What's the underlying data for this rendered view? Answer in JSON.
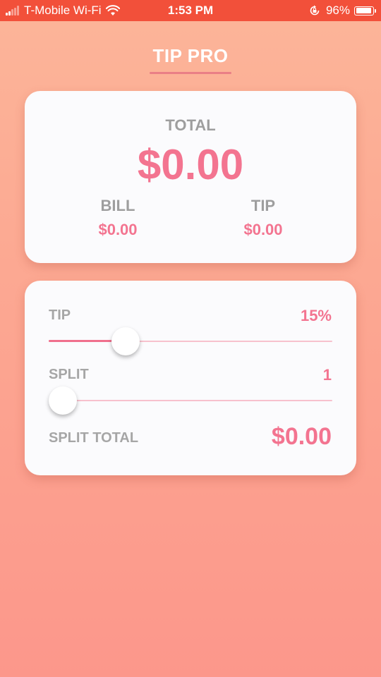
{
  "status_bar": {
    "carrier": "T-Mobile Wi-Fi",
    "time": "1:53 PM",
    "battery_percent": "96%",
    "battery_level": 0.96,
    "signal_bars": 2,
    "signal_total": 5,
    "icons": [
      "signal-icon",
      "wifi-icon",
      "orientation-lock-icon",
      "battery-icon"
    ],
    "background_color": "#f2503a"
  },
  "header": {
    "title": "TIP PRO"
  },
  "totals": {
    "total_label": "TOTAL",
    "total_value": "$0.00",
    "bill_label": "BILL",
    "bill_value": "$0.00",
    "tip_label": "TIP",
    "tip_value": "$0.00"
  },
  "controls": {
    "tip_label": "TIP",
    "tip_value": "15%",
    "tip_slider_fraction": 0.27,
    "split_label": "SPLIT",
    "split_value": "1",
    "split_slider_fraction": 0.0,
    "split_total_label": "SPLIT TOTAL",
    "split_total_value": "$0.00"
  },
  "colors": {
    "accent": "#f37490",
    "label_gray": "#9e9e9e",
    "card_background": "#fbfbfd",
    "background_top": "#fcb599",
    "background_bottom": "#fc978b"
  }
}
